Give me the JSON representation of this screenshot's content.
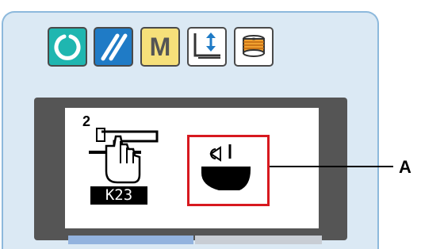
{
  "toolbar": {
    "buttons": [
      {
        "name": "ready-button",
        "icon": "ready-ring-icon",
        "color": "#1fb6b0"
      },
      {
        "name": "reset-button",
        "icon": "reset-slash-icon",
        "color": "#1f7bc6"
      },
      {
        "name": "mode-button",
        "label": "M",
        "color": "#f6e07a"
      },
      {
        "name": "presser-lift-button",
        "icon": "presser-foot-lift-icon"
      },
      {
        "name": "bobbin-winder-button",
        "icon": "bobbin-winder-icon"
      }
    ]
  },
  "screen": {
    "left_item": {
      "superscript": "2",
      "icon": "pattern-hand-icon",
      "code": "K23"
    },
    "right_item": {
      "icon": "thread-tension-icon"
    }
  },
  "callout": {
    "label": "A",
    "highlight_color": "#d7191f"
  }
}
